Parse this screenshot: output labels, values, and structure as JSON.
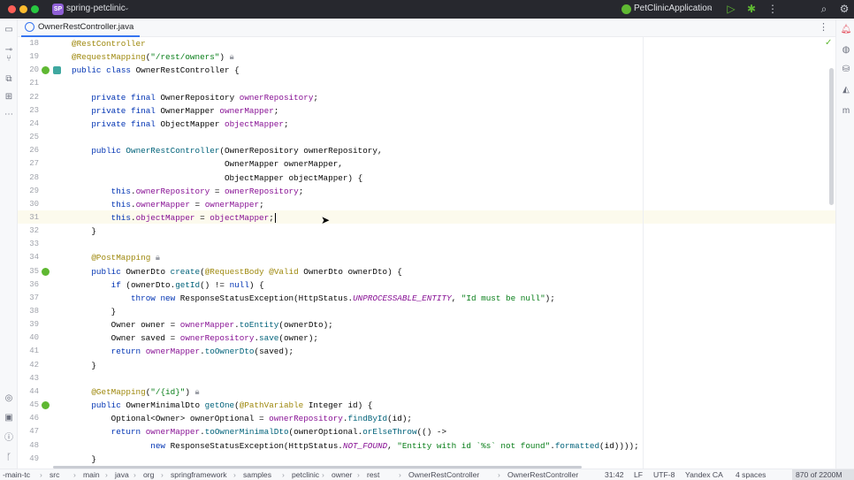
{
  "titlebar": {
    "project_badge": "SP",
    "project_name": "spring-petclinic",
    "run_config": "PetClinicApplication"
  },
  "tab": {
    "label": "OwnerRestController.java"
  },
  "editor": {
    "lines": [
      {
        "n": "18",
        "text": "@RestController"
      },
      {
        "n": "19",
        "text": "@RequestMapping(\"/rest/owners\")"
      },
      {
        "n": "20",
        "text": "public class OwnerRestController {"
      },
      {
        "n": "21",
        "text": ""
      },
      {
        "n": "22",
        "text": "    private final OwnerRepository ownerRepository;"
      },
      {
        "n": "23",
        "text": "    private final OwnerMapper ownerMapper;"
      },
      {
        "n": "24",
        "text": "    private final ObjectMapper objectMapper;"
      },
      {
        "n": "25",
        "text": ""
      },
      {
        "n": "26",
        "text": "    public OwnerRestController(OwnerRepository ownerRepository,"
      },
      {
        "n": "27",
        "text": "                               OwnerMapper ownerMapper,"
      },
      {
        "n": "28",
        "text": "                               ObjectMapper objectMapper) {"
      },
      {
        "n": "29",
        "text": "        this.ownerRepository = ownerRepository;"
      },
      {
        "n": "30",
        "text": "        this.ownerMapper = ownerMapper;"
      },
      {
        "n": "31",
        "text": "        this.objectMapper = objectMapper;"
      },
      {
        "n": "32",
        "text": "    }"
      },
      {
        "n": "33",
        "text": ""
      },
      {
        "n": "34",
        "text": "    @PostMapping"
      },
      {
        "n": "35",
        "text": "    public OwnerDto create(@RequestBody @Valid OwnerDto ownerDto) {"
      },
      {
        "n": "36",
        "text": "        if (ownerDto.getId() != null) {"
      },
      {
        "n": "37",
        "text": "            throw new ResponseStatusException(HttpStatus.UNPROCESSABLE_ENTITY, \"Id must be null\");"
      },
      {
        "n": "38",
        "text": "        }"
      },
      {
        "n": "39",
        "text": "        Owner owner = ownerMapper.toEntity(ownerDto);"
      },
      {
        "n": "40",
        "text": "        Owner saved = ownerRepository.save(owner);"
      },
      {
        "n": "41",
        "text": "        return ownerMapper.toOwnerDto(saved);"
      },
      {
        "n": "42",
        "text": "    }"
      },
      {
        "n": "43",
        "text": ""
      },
      {
        "n": "44",
        "text": "    @GetMapping(\"/{id}\")"
      },
      {
        "n": "45",
        "text": "    public OwnerMinimalDto getOne(@PathVariable Integer id) {"
      },
      {
        "n": "46",
        "text": "        Optional<Owner> ownerOptional = ownerRepository.findById(id);"
      },
      {
        "n": "47",
        "text": "        return ownerMapper.toOwnerMinimalDto(ownerOptional.orElseThrow(() ->"
      },
      {
        "n": "48",
        "text": "                new ResponseStatusException(HttpStatus.NOT_FOUND, \"Entity with id `%s` not found\".formatted(id))));"
      },
      {
        "n": "49",
        "text": "    }"
      }
    ]
  },
  "statusbar": {
    "breadcrumbs": [
      "-main-tc",
      "src",
      "main",
      "java",
      "org",
      "springframework",
      "samples",
      "petclinic",
      "owner",
      "rest",
      "OwnerRestController",
      "OwnerRestController"
    ],
    "position": "31:42",
    "line_sep": "LF",
    "encoding": "UTF-8",
    "ai": "Yandex CA",
    "indent": "4 spaces",
    "memory": "870 of 2200M"
  },
  "colors": {
    "keyword": "#0033b3",
    "annotation": "#9e880d",
    "field": "#871094",
    "method": "#00627a",
    "string": "#067d17",
    "accent": "#3574f0"
  },
  "icons": [
    "folder-icon",
    "commit-icon",
    "pull-request-icon",
    "structure-icon",
    "more-icon",
    "run-icon",
    "debug-icon",
    "search-icon",
    "settings-icon",
    "notifications-icon",
    "database-icon",
    "gradle-icon",
    "maven-icon",
    "run-tree-icon",
    "terminal-icon",
    "problems-icon",
    "git-icon"
  ]
}
